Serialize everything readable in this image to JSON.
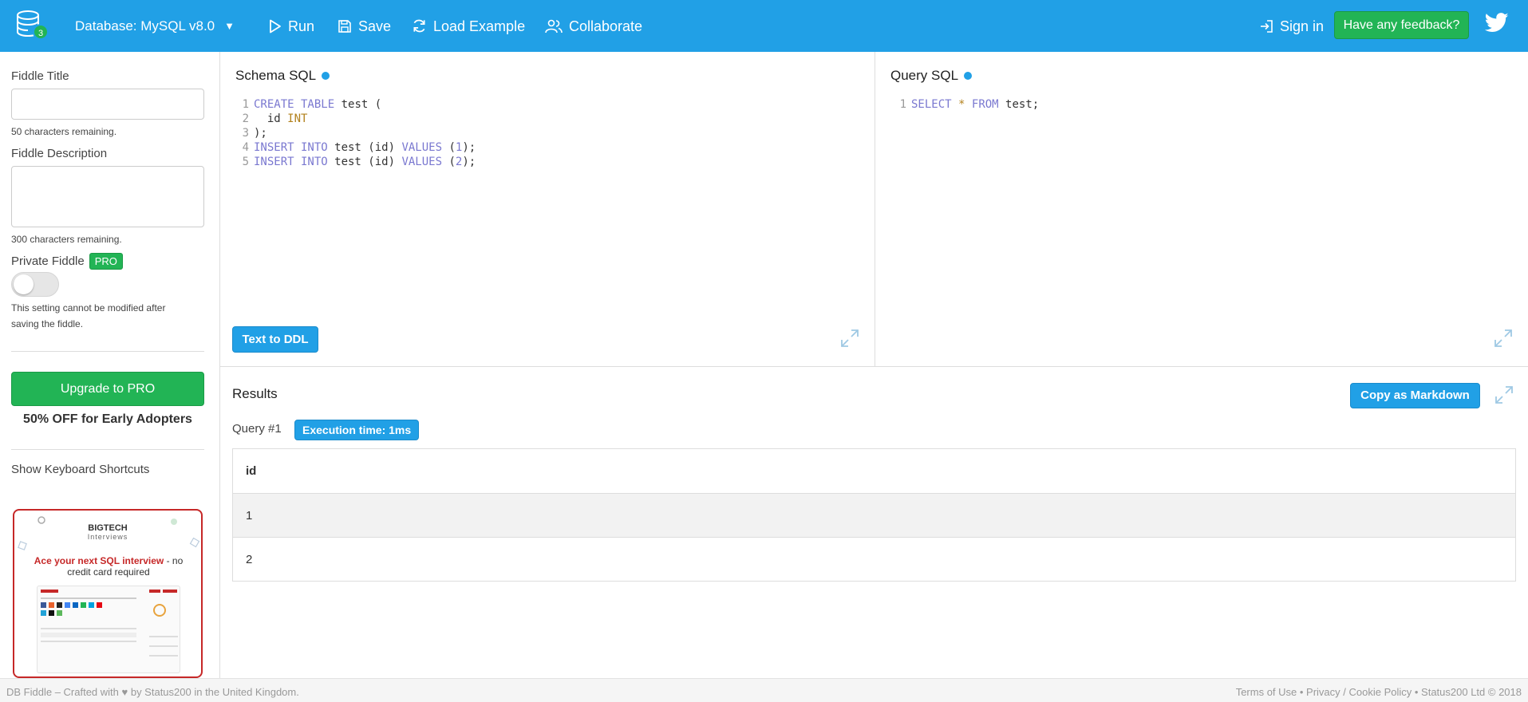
{
  "header": {
    "db_count": "3",
    "database_label": "Database: MySQL v8.0",
    "run": "Run",
    "save": "Save",
    "load_example": "Load Example",
    "collaborate": "Collaborate",
    "sign_in": "Sign in",
    "feedback": "Have any feedback?",
    "icons": [
      "database-icon",
      "play-icon",
      "save-icon",
      "refresh-icon",
      "users-icon",
      "sign-in-icon",
      "twitter-icon"
    ]
  },
  "sidebar": {
    "title_label": "Fiddle Title",
    "title_value": "",
    "title_hint": "50 characters remaining.",
    "description_label": "Fiddle Description",
    "description_value": "",
    "description_hint": "300 characters remaining.",
    "private_label": "Private Fiddle",
    "pro_badge": "PRO",
    "private_enabled": false,
    "private_hint_1": "This setting cannot be modified after",
    "private_hint_2": "saving the fiddle.",
    "upgrade": "Upgrade to PRO",
    "discount": "50% OFF for Early Adopters",
    "shortcuts": "Show Keyboard Shortcuts",
    "ad": {
      "brand": "BIGTECH",
      "brand_sub": "Interviews",
      "headline_bold": "Ace your next SQL interview",
      "headline_rest": " - no credit card required"
    }
  },
  "schema": {
    "title": "Schema SQL",
    "lines": [
      {
        "n": "1",
        "parts": [
          [
            "kw",
            "CREATE TABLE"
          ],
          [
            "",
            " test ("
          ]
        ]
      },
      {
        "n": "2",
        "parts": [
          [
            "",
            "  id "
          ],
          [
            "ty",
            "INT"
          ]
        ]
      },
      {
        "n": "3",
        "parts": [
          [
            "",
            ");"
          ]
        ]
      },
      {
        "n": "4",
        "parts": [
          [
            "kw",
            "INSERT INTO"
          ],
          [
            "",
            " test (id) "
          ],
          [
            "kw",
            "VALUES"
          ],
          [
            "",
            " ("
          ],
          [
            "nm",
            "1"
          ],
          [
            "",
            ");"
          ]
        ]
      },
      {
        "n": "5",
        "parts": [
          [
            "kw",
            "INSERT INTO"
          ],
          [
            "",
            " test (id) "
          ],
          [
            "kw",
            "VALUES"
          ],
          [
            "",
            " ("
          ],
          [
            "nm",
            "2"
          ],
          [
            "",
            ");"
          ]
        ]
      }
    ],
    "text_to_ddl": "Text to DDL"
  },
  "query": {
    "title": "Query SQL",
    "lines": [
      {
        "n": "1",
        "parts": [
          [
            "kw",
            "SELECT"
          ],
          [
            "",
            " "
          ],
          [
            "ty",
            "*"
          ],
          [
            "",
            " "
          ],
          [
            "kw",
            "FROM"
          ],
          [
            "",
            " test;"
          ]
        ]
      }
    ]
  },
  "results": {
    "title": "Results",
    "copy_markdown": "Copy as Markdown",
    "query_label": "Query #1",
    "execution_time": "Execution time: 1ms",
    "columns": [
      "id"
    ],
    "rows": [
      [
        "1"
      ],
      [
        "2"
      ]
    ]
  },
  "footer": {
    "left": "DB Fiddle – Crafted with ♥ by Status200 in the United Kingdom.",
    "terms": "Terms of Use",
    "privacy": "Privacy / Cookie Policy",
    "copyright": "Status200 Ltd © 2018",
    "sep": " • "
  },
  "colors": {
    "brand_blue": "#21a0e6",
    "green": "#22b455",
    "ad_red": "#c62828"
  }
}
